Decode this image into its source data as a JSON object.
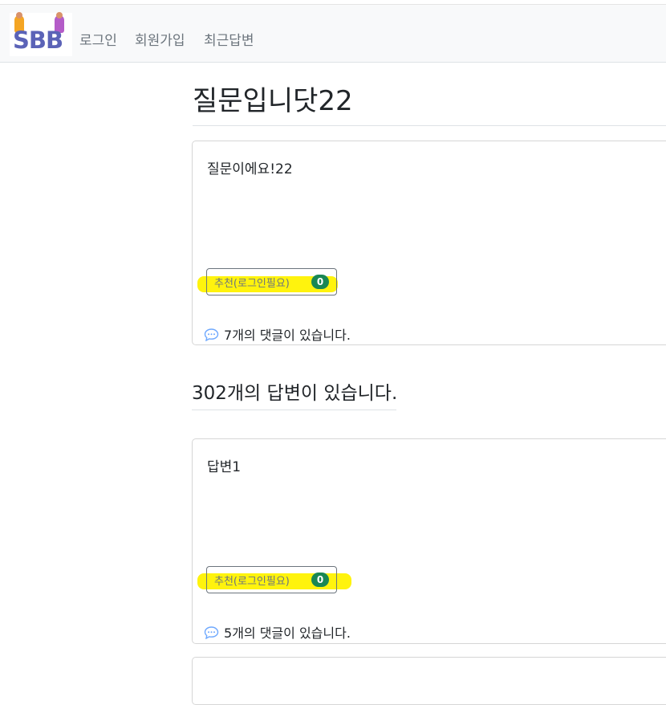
{
  "navbar": {
    "logo_text": "SBB",
    "links": [
      "로그인",
      "회원가입",
      "최근답변"
    ]
  },
  "question": {
    "title": "질문입니닷22",
    "content": "질문이에요!22",
    "vote_label": "추천(로그인필요)",
    "vote_count": "0",
    "comment_count": "7",
    "comment_suffix": "개의 댓글이 있습니다."
  },
  "answers": {
    "heading": "302개의 답변이 있습니다.",
    "items": [
      {
        "content": "답변1",
        "vote_label": "추천(로그인필요)",
        "vote_count": "0",
        "comment_count": "5",
        "comment_suffix": "개의 댓글이 있습니다."
      }
    ]
  },
  "colors": {
    "highlight": "#fff200",
    "badge": "#198754",
    "comment_icon": "#6ea8fe"
  }
}
